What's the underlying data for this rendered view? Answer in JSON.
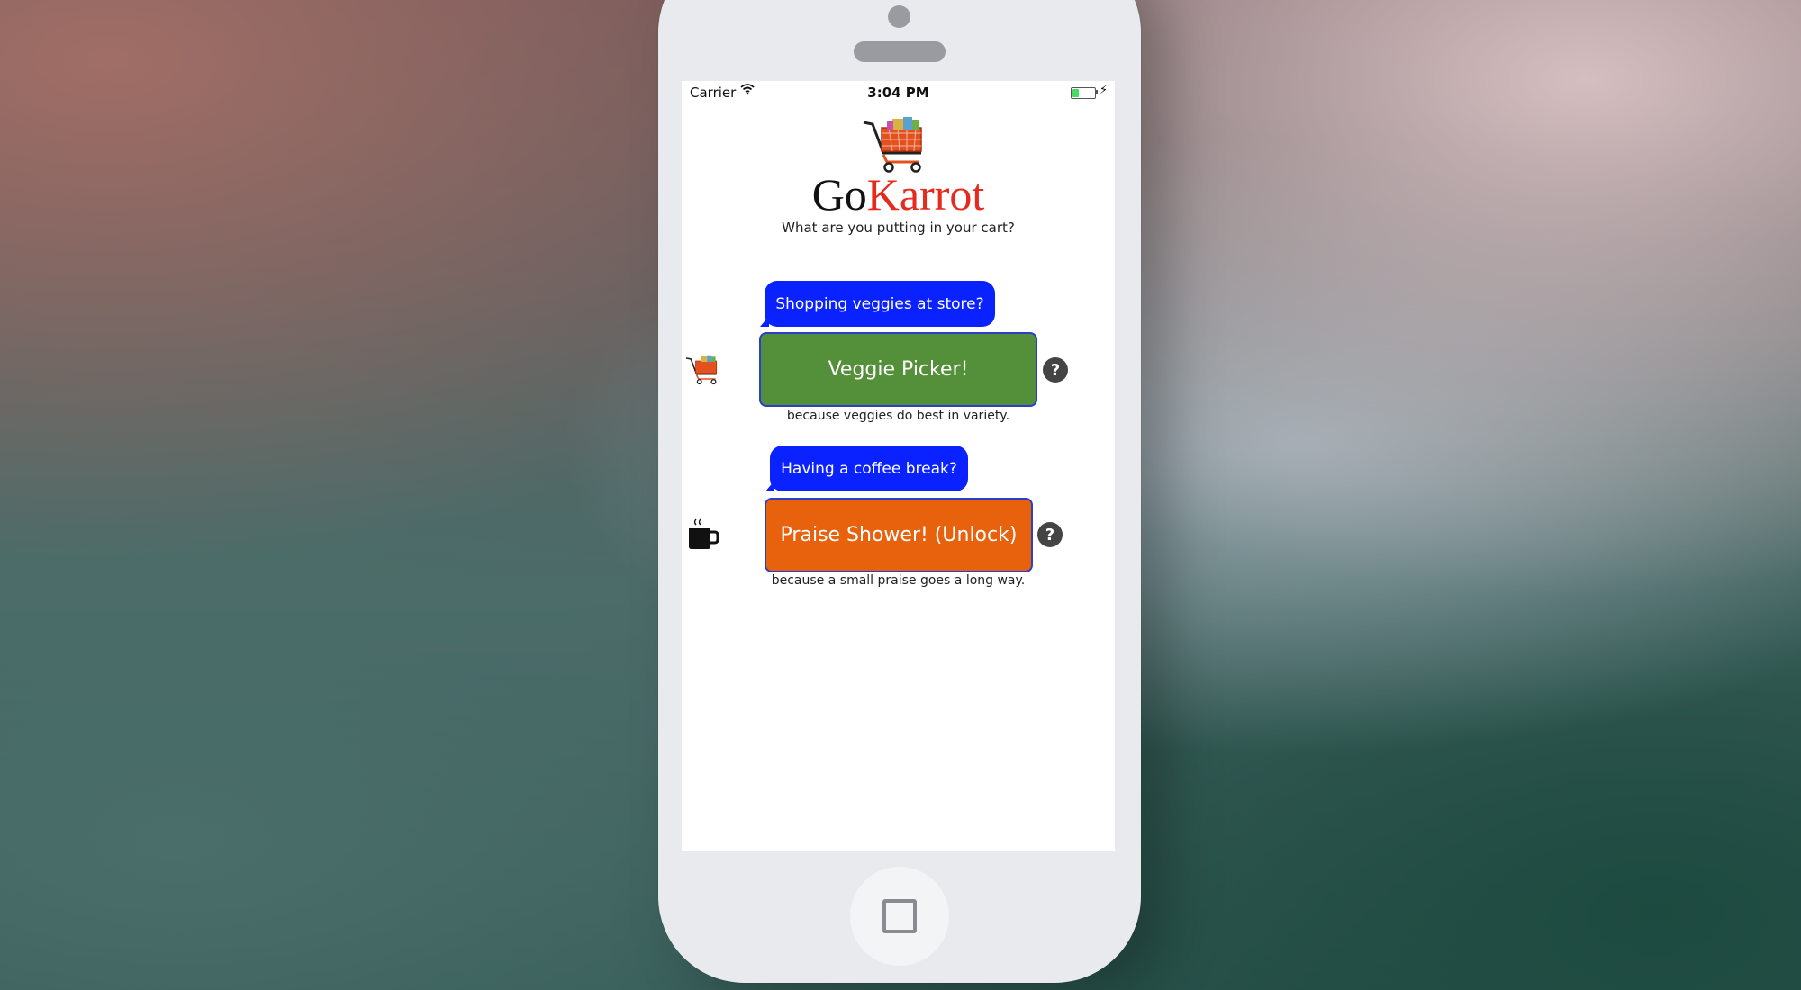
{
  "status_bar": {
    "carrier": "Carrier",
    "time": "3:04 PM",
    "battery_level": 0.3
  },
  "header": {
    "brand_go": "Go",
    "brand_karrot": "Karrot",
    "subtitle": "What are you putting in your cart?"
  },
  "rows": [
    {
      "prompt": "Shopping veggies at store?",
      "button_label": "Veggie Picker!",
      "caption": "because veggies do best in variety.",
      "icon": "shopping-cart-icon",
      "button_color": "#54903a"
    },
    {
      "prompt": "Having a coffee break?",
      "button_label": "Praise Shower! (Unlock)",
      "caption": "because a small praise goes a long way.",
      "icon": "coffee-mug-icon",
      "button_color": "#e8620e"
    }
  ],
  "help_label": "?",
  "colors": {
    "bubble": "#0a22ff",
    "brand_accent": "#e62a1e"
  }
}
